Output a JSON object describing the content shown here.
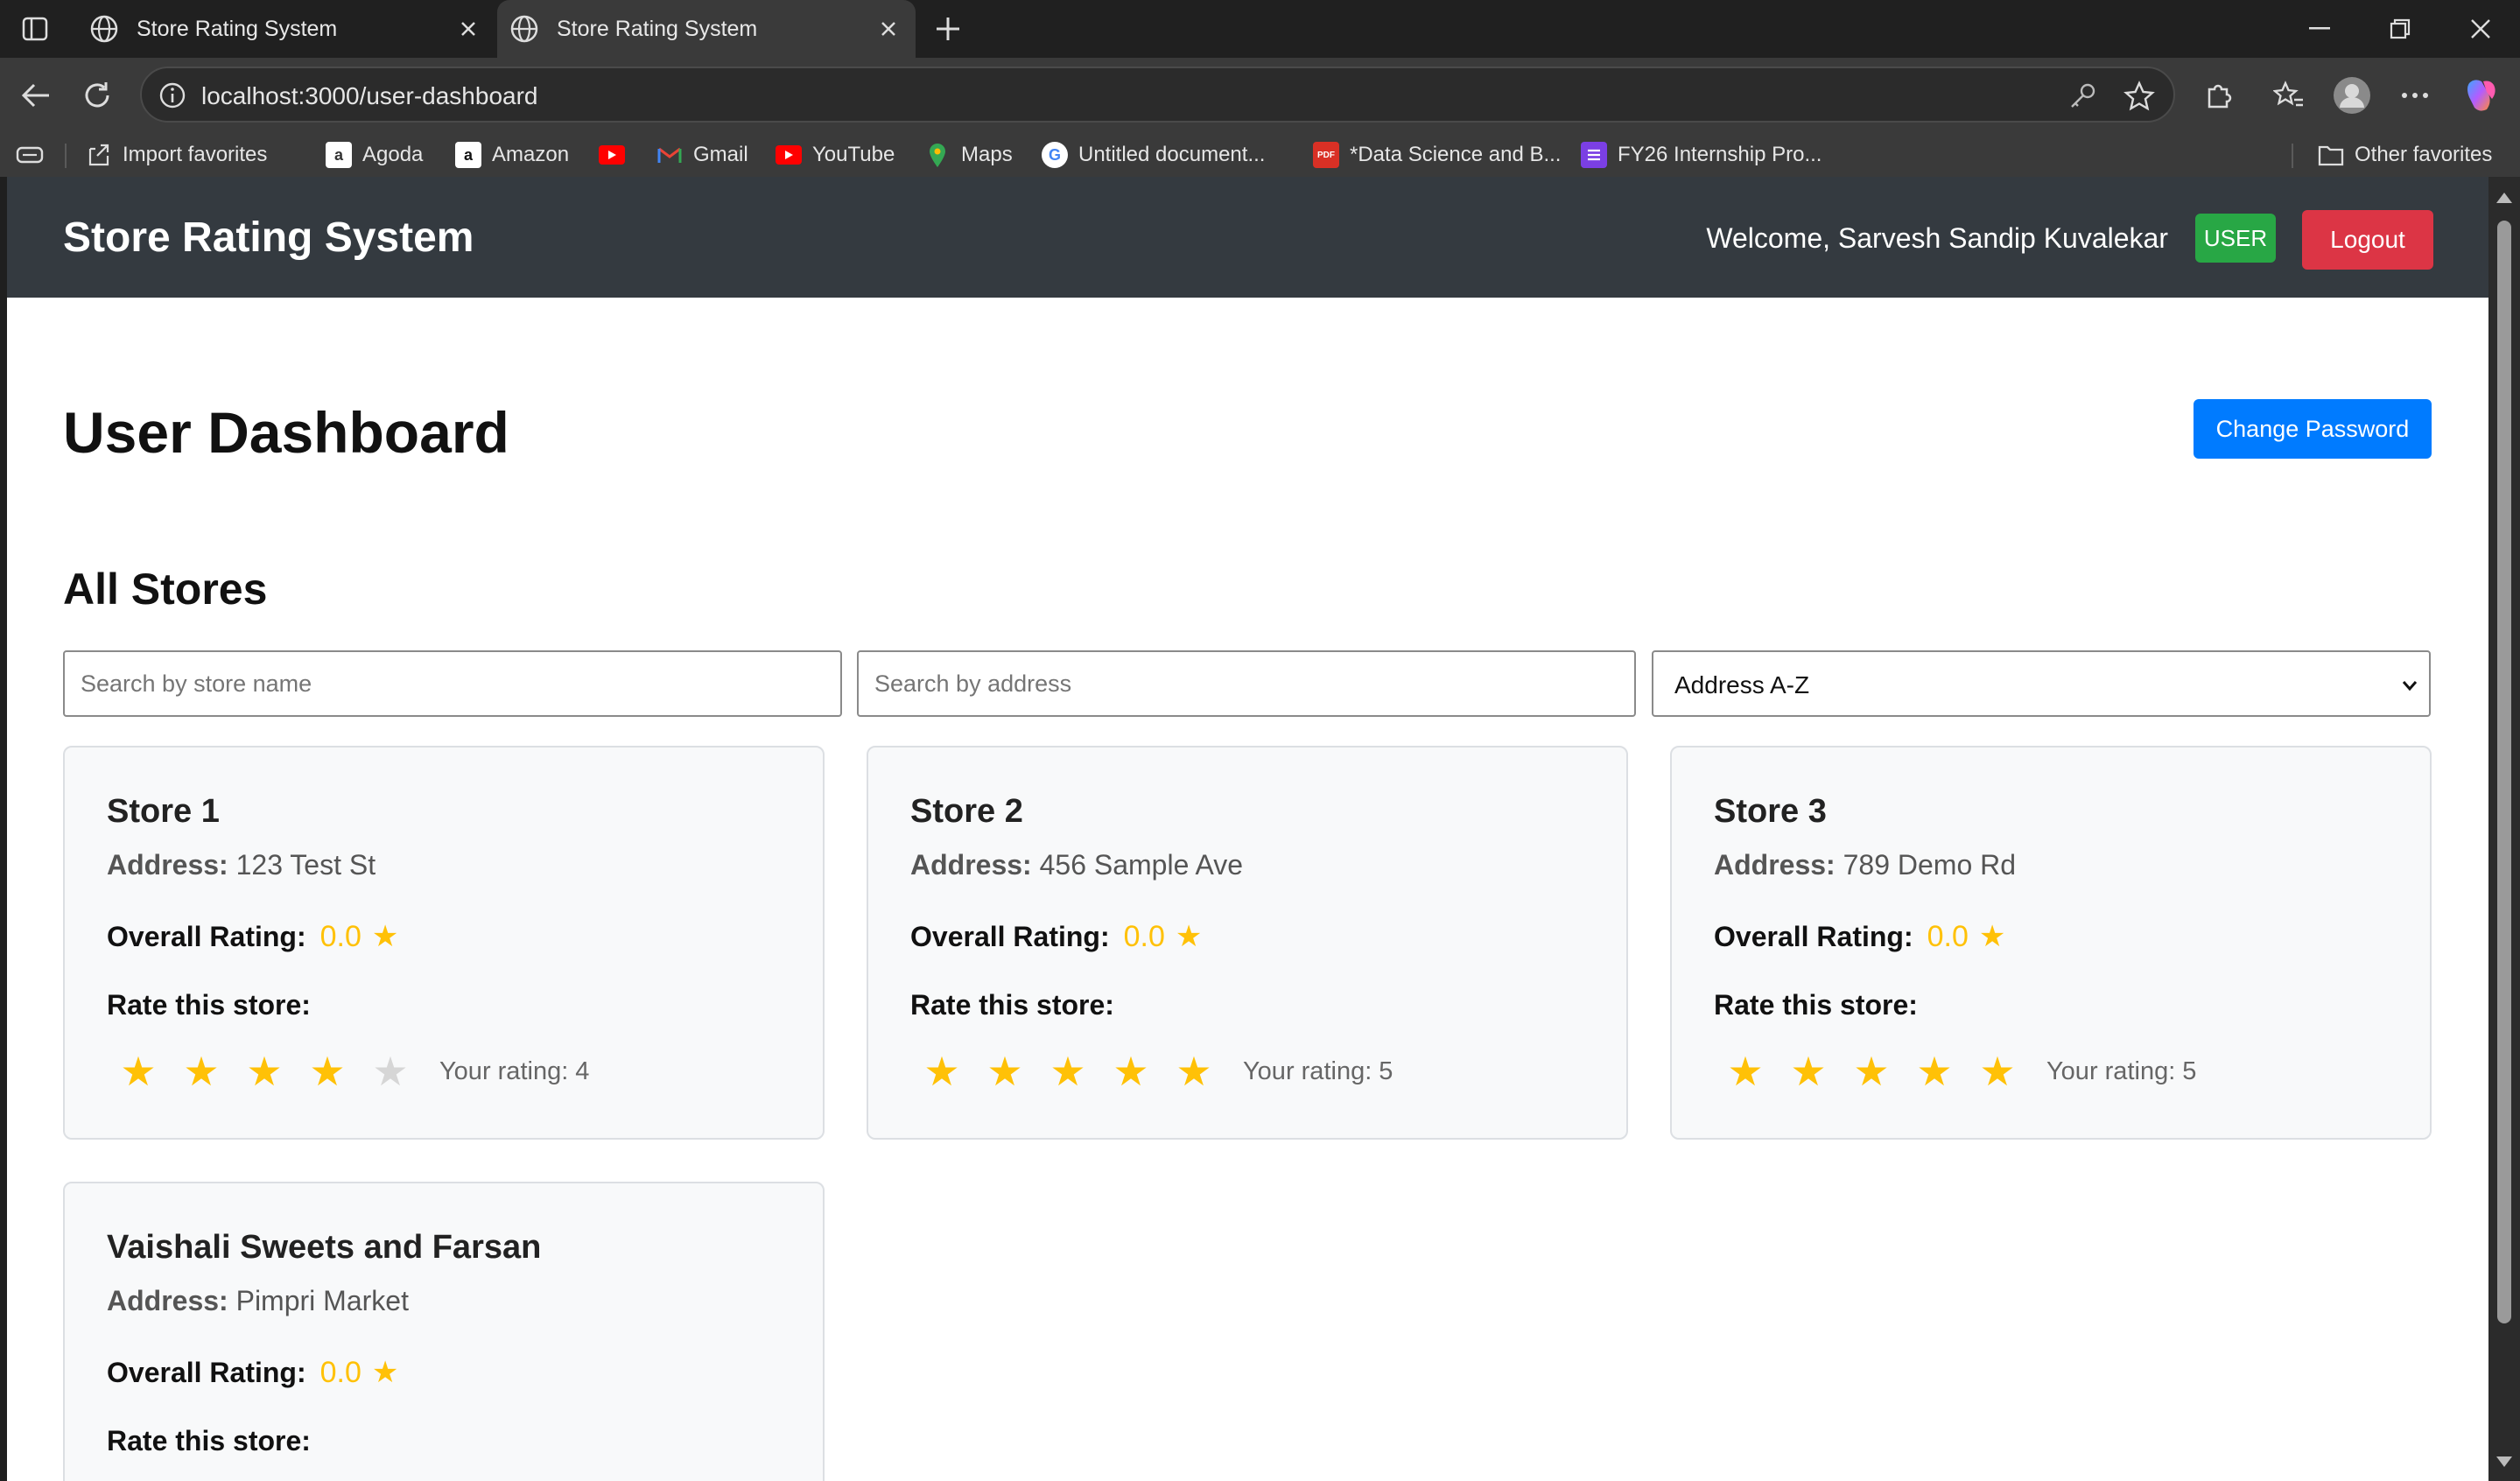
{
  "browser": {
    "tabs": [
      {
        "title": "Store Rating System"
      },
      {
        "title": "Store Rating System"
      }
    ],
    "url": "localhost:3000/user-dashboard",
    "bookmarks": [
      {
        "label": "Import favorites"
      },
      {
        "label": "Agoda"
      },
      {
        "label": "Amazon"
      },
      {
        "label": ""
      },
      {
        "label": "Gmail"
      },
      {
        "label": "YouTube"
      },
      {
        "label": "Maps"
      },
      {
        "label": "Untitled document..."
      },
      {
        "label": "*Data Science and B..."
      },
      {
        "label": "FY26 Internship Pro..."
      },
      {
        "label": "Other favorites"
      }
    ]
  },
  "header": {
    "app_title": "Store Rating System",
    "welcome": "Welcome, Sarvesh Sandip Kuvalekar",
    "role_badge": "USER",
    "logout_label": "Logout"
  },
  "page": {
    "title": "User Dashboard",
    "change_password_label": "Change Password",
    "section_title": "All Stores"
  },
  "filters": {
    "name_placeholder": "Search by store name",
    "address_placeholder": "Search by address",
    "sort_value": "Address A-Z"
  },
  "labels": {
    "address": "Address:",
    "overall_rating": "Overall Rating:",
    "rate_this_store": "Rate this store:"
  },
  "stores": [
    {
      "name": "Store 1",
      "address": "123 Test St",
      "overall_rating": "0.0",
      "user_rating": 4,
      "your_rating_text": "Your rating: 4"
    },
    {
      "name": "Store 2",
      "address": "456 Sample Ave",
      "overall_rating": "0.0",
      "user_rating": 5,
      "your_rating_text": "Your rating: 5"
    },
    {
      "name": "Store 3",
      "address": "789 Demo Rd",
      "overall_rating": "0.0",
      "user_rating": 5,
      "your_rating_text": "Your rating: 5"
    },
    {
      "name": "Vaishali Sweets and Farsan",
      "address": "Pimpri Market",
      "overall_rating": "0.0",
      "user_rating": null,
      "your_rating_text": ""
    }
  ],
  "colors": {
    "header_bg": "#343a40",
    "badge_green": "#28a745",
    "logout_red": "#dc3545",
    "primary_blue": "#007bff",
    "star_gold": "#ffc107"
  }
}
